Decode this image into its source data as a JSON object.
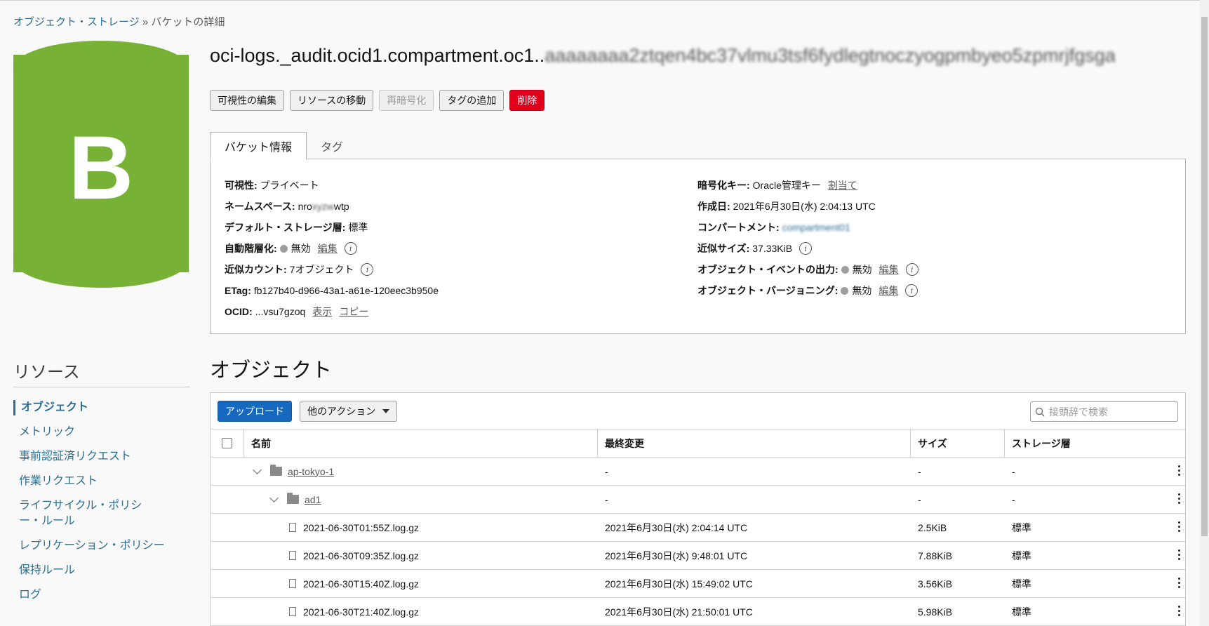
{
  "breadcrumb": {
    "root": "オブジェクト・ストレージ",
    "sep": "»",
    "current": "バケットの詳細"
  },
  "logo": {
    "letter": "B",
    "color": "#77b135"
  },
  "bucket": {
    "title_prefix": "oci-logs._audit.ocid1.compartment.oc1..",
    "title_blurred": "aaaaaaaa2ztqen4bc37vlmu3tsf6fydlegtnoczyogpmbyeo5zpmrjfgsga"
  },
  "actions": {
    "edit_visibility": "可視性の編集",
    "move_resource": "リソースの移動",
    "reencrypt": "再暗号化",
    "add_tag": "タグの追加",
    "delete": "削除"
  },
  "tabs": {
    "info": "バケット情報",
    "tags": "タグ"
  },
  "info": {
    "visibility_k": "可視性:",
    "visibility_v": "プライベート",
    "namespace_k": "ネームスペース:",
    "namespace_v1": "nro",
    "namespace_blur": "xyzw",
    "namespace_v2": "wtp",
    "tier_k": "デフォルト・ストレージ層:",
    "tier_v": "標準",
    "autotier_k": "自動階層化:",
    "autotier_v": "無効",
    "autotier_edit": "編集",
    "count_k": "近似カウント:",
    "count_v": "7オブジェクト",
    "etag_k": "ETag:",
    "etag_v": "fb127b40-d966-43a1-a61e-120eec3b950e",
    "ocid_k": "OCID:",
    "ocid_v": "...vsu7gzoq",
    "ocid_show": "表示",
    "ocid_copy": "コピー",
    "enc_k": "暗号化キー:",
    "enc_v": "Oracle管理キー",
    "enc_assign": "割当て",
    "created_k": "作成日:",
    "created_v": "2021年6月30日(水) 2:04:13 UTC",
    "compartment_k": "コンパートメント:",
    "compartment_v": "compartment01",
    "size_k": "近似サイズ:",
    "size_v": "37.33KiB",
    "events_k": "オブジェクト・イベントの出力:",
    "events_v": "無効",
    "events_edit": "編集",
    "versioning_k": "オブジェクト・バージョニング:",
    "versioning_v": "無効",
    "versioning_edit": "編集"
  },
  "resources": {
    "heading": "リソース",
    "items": [
      "オブジェクト",
      "メトリック",
      "事前認証済リクエスト",
      "作業リクエスト",
      "ライフサイクル・ポリシー・ルール",
      "レプリケーション・ポリシー",
      "保持ルール",
      "ログ"
    ]
  },
  "objects": {
    "heading": "オブジェクト",
    "upload": "アップロード",
    "more_actions": "他のアクション",
    "search_placeholder": "接頭辞で検索",
    "columns": {
      "name": "名前",
      "modified": "最終変更",
      "size": "サイズ",
      "tier": "ストレージ層"
    },
    "rows": [
      {
        "name": "ap-tokyo-1",
        "modified": "-",
        "size": "-",
        "tier": "-"
      },
      {
        "name": "ad1",
        "modified": "-",
        "size": "-",
        "tier": "-"
      },
      {
        "name": "2021-06-30T01:55Z.log.gz",
        "modified": "2021年6月30日(水) 2:04:14 UTC",
        "size": "2.5KiB",
        "tier": "標準"
      },
      {
        "name": "2021-06-30T09:35Z.log.gz",
        "modified": "2021年6月30日(水) 9:48:01 UTC",
        "size": "7.88KiB",
        "tier": "標準"
      },
      {
        "name": "2021-06-30T15:40Z.log.gz",
        "modified": "2021年6月30日(水) 15:49:02 UTC",
        "size": "3.56KiB",
        "tier": "標準"
      },
      {
        "name": "2021-06-30T21:40Z.log.gz",
        "modified": "2021年6月30日(水) 21:50:01 UTC",
        "size": "5.98KiB",
        "tier": "標準"
      }
    ]
  }
}
